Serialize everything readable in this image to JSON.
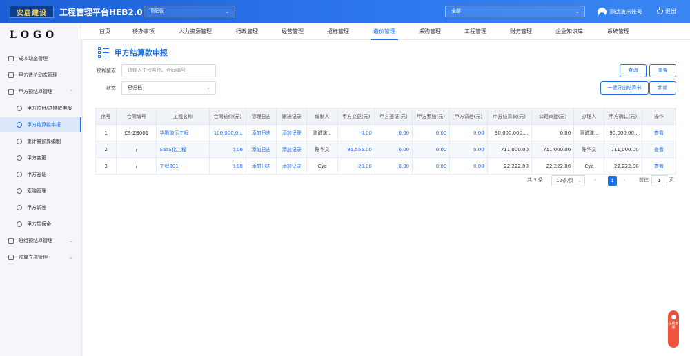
{
  "header": {
    "logo_text": "安居建设",
    "app_title": "工程管理平台HEB2.0",
    "version_value": "顶配版",
    "project_value": "全部",
    "username": "测试演示账号",
    "logout_label": "退出"
  },
  "sidebar": {
    "logo": "LOGO",
    "items": [
      {
        "label": "成本动态管理"
      },
      {
        "label": "甲方造价动态管理"
      },
      {
        "label": "甲方预结算管理"
      },
      {
        "label": "甲方预付/进度款申报"
      },
      {
        "label": "甲方结算款申报"
      },
      {
        "label": "重计量预算编制"
      },
      {
        "label": "甲方变更"
      },
      {
        "label": "甲方签证"
      },
      {
        "label": "索赔管理"
      },
      {
        "label": "甲方调差"
      },
      {
        "label": "甲方质保金"
      },
      {
        "label": "班组预结算管理"
      },
      {
        "label": "预算立项管理"
      }
    ]
  },
  "nav": [
    "首页",
    "待办事项",
    "人力资源管理",
    "行政管理",
    "经营管理",
    "招标管理",
    "造价管理",
    "采购管理",
    "工程管理",
    "财务管理",
    "企业知识库",
    "系统管理"
  ],
  "page": {
    "title": "甲方结算款申报",
    "search_label": "模糊搜索",
    "search_placeholder": "请输入工程名称、合同编号",
    "status_label": "状态",
    "status_value": "已归档",
    "query_btn": "查询",
    "reset_btn": "重置",
    "export_btn": "一键导出结算书",
    "add_btn": "新增"
  },
  "table": {
    "headers": [
      "序号",
      "合同编号",
      "工程名称",
      "合同总价(元)",
      "管理日志",
      "跟进记录",
      "编制人",
      "甲方变更(元)",
      "甲方签证(元)",
      "甲方索赔(元)",
      "甲方调差(元)",
      "申报结算款(元)",
      "公司审批(元)",
      "办理人",
      "甲方确认(元)",
      "操作"
    ],
    "rows": [
      [
        "1",
        "CS-ZB001",
        "华腾演示工程",
        "100,000,0...",
        "添加日志",
        "添加记录",
        "测试演...",
        "0.00",
        "0.00",
        "0.00",
        "0.00",
        "90,000,000....",
        "0.00",
        "测试演...",
        "90,000,00...",
        "查看"
      ],
      [
        "2",
        "/",
        "SaaS化工程",
        "0.00",
        "添加日志",
        "添加记录",
        "陈华文",
        "95,555.00",
        "0.00",
        "0.00",
        "0.00",
        "711,000.00",
        "711,000.00",
        "陈华文",
        "711,000.00",
        "查看"
      ],
      [
        "3",
        "/",
        "工程001",
        "0.00",
        "添加日志",
        "添加记录",
        "Cyc",
        "20.00",
        "0.00",
        "0.00",
        "0.00",
        "22,222.00",
        "22,222.00",
        "Cyc",
        "22,222.00",
        "查看"
      ]
    ]
  },
  "pagination": {
    "total": "共 3 条",
    "page_size": "12条/页",
    "current": "1",
    "goto_label": "前往",
    "goto_value": "1",
    "page_suffix": "页"
  },
  "float_service": "在线客服",
  "colors": {
    "primary": "#1f6fe5",
    "header_gradient": "#1b5fd6",
    "float": "#f1523d"
  }
}
